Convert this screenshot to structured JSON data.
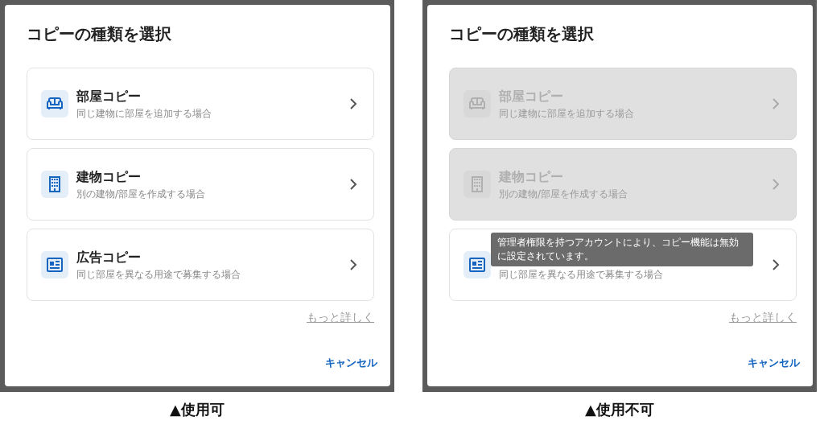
{
  "panels": [
    {
      "dialog_title": "コピーの種類を選択",
      "options": [
        {
          "kind": "room",
          "title": "部屋コピー",
          "description": "同じ建物に部屋を追加する場合",
          "disabled": false
        },
        {
          "kind": "building",
          "title": "建物コピー",
          "description": "別の建物/部屋を作成する場合",
          "disabled": false
        },
        {
          "kind": "ad",
          "title": "広告コピー",
          "description": "同じ部屋を異なる用途で募集する場合",
          "disabled": false
        }
      ],
      "more_link": "もっと詳しく",
      "cancel_button": "キャンセル",
      "caption": "▲使用可"
    },
    {
      "dialog_title": "コピーの種類を選択",
      "options": [
        {
          "kind": "room",
          "title": "部屋コピー",
          "description": "同じ建物に部屋を追加する場合",
          "disabled": true
        },
        {
          "kind": "building",
          "title": "建物コピー",
          "description": "別の建物/部屋を作成する場合",
          "disabled": true
        },
        {
          "kind": "ad",
          "description": "同じ部屋を異なる用途で募集する場合",
          "disabled": false,
          "tooltip": "管理者権限を持つアカウントにより、コピー機能は無効に設定されています。"
        }
      ],
      "more_link": "もっと詳しく",
      "cancel_button": "キャンセル",
      "caption": "▲使用不可"
    }
  ]
}
